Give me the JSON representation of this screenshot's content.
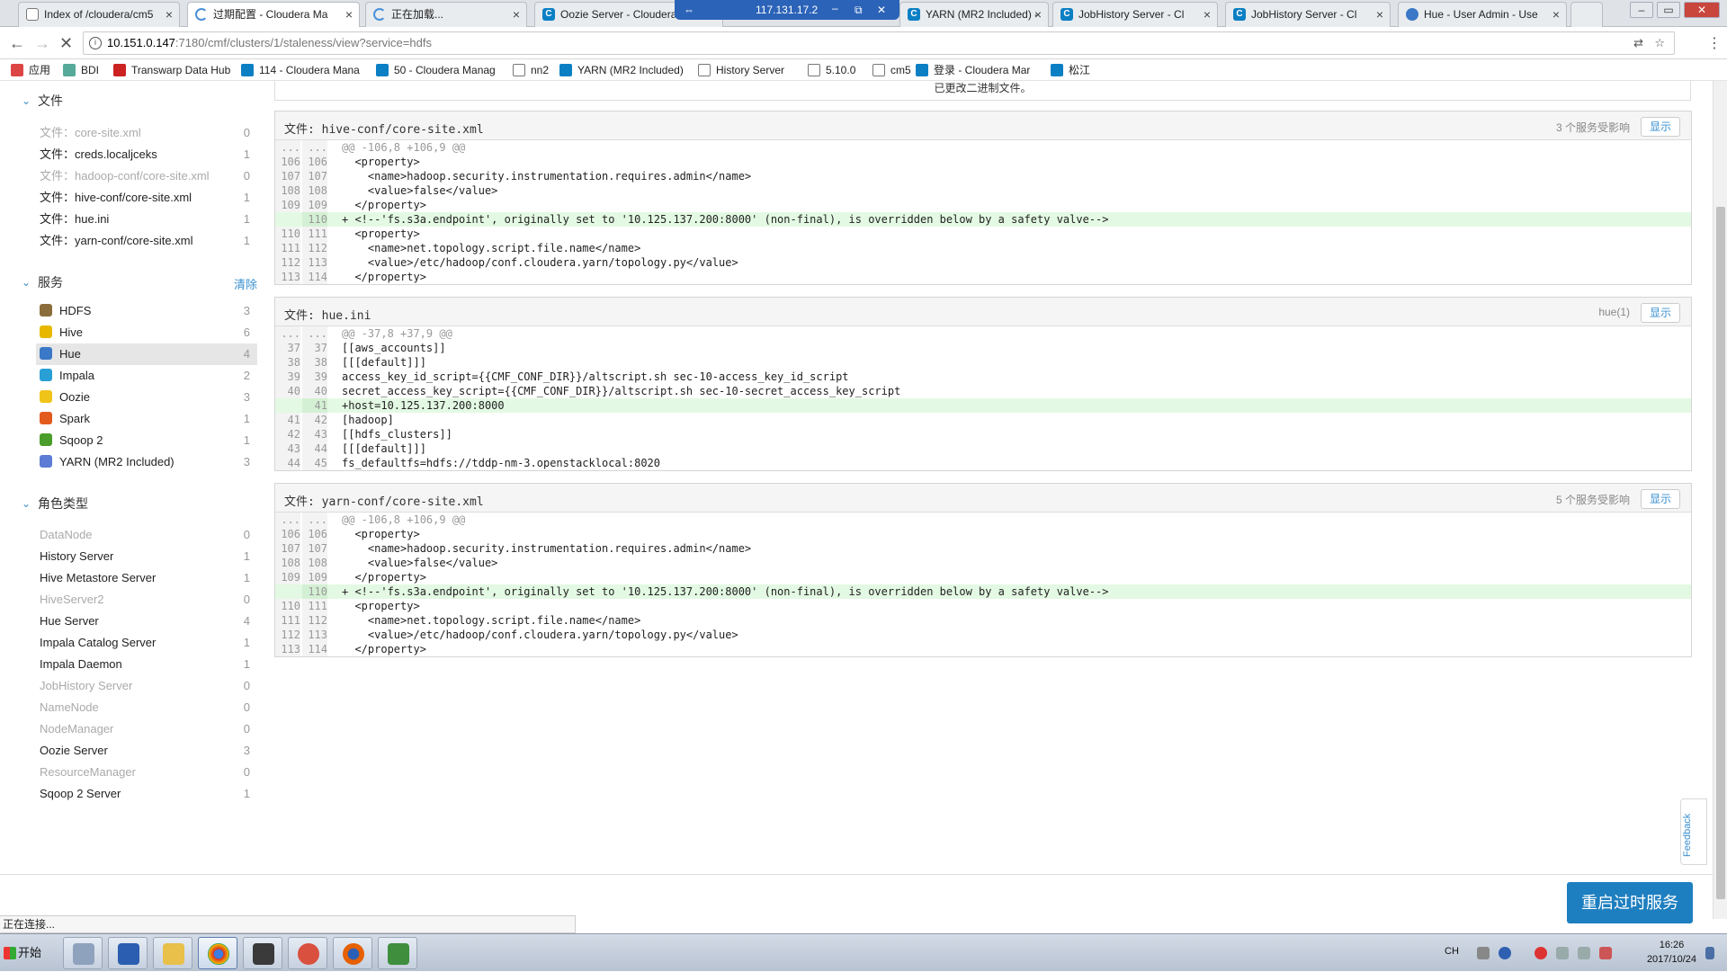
{
  "browser": {
    "tabs": [
      {
        "label": "Index of /cloudera/cm5",
        "icon": "doc"
      },
      {
        "label": "过期配置 - Cloudera Ma",
        "icon": "spinner",
        "active": true
      },
      {
        "label": "正在加载...",
        "icon": "spinner"
      },
      {
        "label": "Oozie Server - Cloudera",
        "icon": "cloudera"
      },
      {
        "label": "YARN (MR2 Included) - ",
        "icon": "cloudera"
      },
      {
        "label": "JobHistory Server - Cl",
        "icon": "cloudera"
      },
      {
        "label": "JobHistory Server - Cl",
        "icon": "cloudera"
      },
      {
        "label": "Hue - User Admin - Use",
        "icon": "hue"
      }
    ],
    "remote_bar_ip": "117.131.17.2",
    "url_host": "10.151.0.147",
    "url_rest": ":7180/cmf/clusters/1/staleness/view?service=hdfs",
    "bookmarks": [
      {
        "label": "应用"
      },
      {
        "label": "BDI"
      },
      {
        "label": "Transwarp Data Hub"
      },
      {
        "label": "114 - Cloudera Mana"
      },
      {
        "label": "50 - Cloudera Manag"
      },
      {
        "label": "nn2"
      },
      {
        "label": "YARN (MR2 Included)"
      },
      {
        "label": "History Server"
      },
      {
        "label": "5.10.0"
      },
      {
        "label": "cm5"
      },
      {
        "label": "登录 - Cloudera Mar"
      },
      {
        "label": "松江"
      }
    ]
  },
  "top_message": "已更改二进制文件。",
  "sidebar": {
    "files_title": "文件",
    "files": [
      {
        "label": "文件：core-site.xml",
        "count": "0",
        "dim": true
      },
      {
        "label": "文件：creds.localjceks",
        "count": "1",
        "dim": false
      },
      {
        "label": "文件：hadoop-conf/core-site.xml",
        "count": "0",
        "dim": true
      },
      {
        "label": "文件：hive-conf/core-site.xml",
        "count": "1",
        "dim": false
      },
      {
        "label": "文件：hue.ini",
        "count": "1",
        "dim": false
      },
      {
        "label": "文件：yarn-conf/core-site.xml",
        "count": "1",
        "dim": false
      }
    ],
    "services_title": "服务",
    "clear_label": "清除",
    "services": [
      {
        "label": "HDFS",
        "count": "3",
        "color": "#8a6d3b"
      },
      {
        "label": "Hive",
        "count": "6",
        "color": "#e6b800"
      },
      {
        "label": "Hue",
        "count": "4",
        "color": "#3b78c7",
        "selected": true
      },
      {
        "label": "Impala",
        "count": "2",
        "color": "#2a9fd6"
      },
      {
        "label": "Oozie",
        "count": "3",
        "color": "#f0c419"
      },
      {
        "label": "Spark",
        "count": "1",
        "color": "#e25a1c"
      },
      {
        "label": "Sqoop 2",
        "count": "1",
        "color": "#4a9d2a"
      },
      {
        "label": "YARN (MR2 Included)",
        "count": "3",
        "color": "#5b7bd5"
      }
    ],
    "roles_title": "角色类型",
    "roles": [
      {
        "label": "DataNode",
        "count": "0",
        "dim": true
      },
      {
        "label": "History Server",
        "count": "1",
        "dim": false
      },
      {
        "label": "Hive Metastore Server",
        "count": "1",
        "dim": false
      },
      {
        "label": "HiveServer2",
        "count": "0",
        "dim": true
      },
      {
        "label": "Hue Server",
        "count": "4",
        "dim": false
      },
      {
        "label": "Impala Catalog Server",
        "count": "1",
        "dim": false
      },
      {
        "label": "Impala Daemon",
        "count": "1",
        "dim": false
      },
      {
        "label": "JobHistory Server",
        "count": "0",
        "dim": true
      },
      {
        "label": "NameNode",
        "count": "0",
        "dim": true
      },
      {
        "label": "NodeManager",
        "count": "0",
        "dim": true
      },
      {
        "label": "Oozie Server",
        "count": "3",
        "dim": false
      },
      {
        "label": "ResourceManager",
        "count": "0",
        "dim": true
      },
      {
        "label": "Sqoop 2 Server",
        "count": "1",
        "dim": false
      }
    ]
  },
  "panels": [
    {
      "title": "文件: hive-conf/core-site.xml",
      "affected": "3 个服务受影响",
      "button": "显示",
      "lines": [
        {
          "a": "...",
          "b": "...",
          "text": "@@ -106,8 +106,9 @@",
          "kind": "hunk"
        },
        {
          "a": "106",
          "b": "106",
          "text": "  <property>",
          "kind": "ctx"
        },
        {
          "a": "107",
          "b": "107",
          "text": "    <name>hadoop.security.instrumentation.requires.admin</name>",
          "kind": "ctx"
        },
        {
          "a": "108",
          "b": "108",
          "text": "    <value>false</value>",
          "kind": "ctx"
        },
        {
          "a": "109",
          "b": "109",
          "text": "  </property>",
          "kind": "ctx"
        },
        {
          "a": "",
          "b": "110",
          "text": "+ <!--'fs.s3a.endpoint', originally set to '10.125.137.200:8000' (non-final), is overridden below by a safety valve-->",
          "kind": "add"
        },
        {
          "a": "110",
          "b": "111",
          "text": "  <property>",
          "kind": "ctx"
        },
        {
          "a": "111",
          "b": "112",
          "text": "    <name>net.topology.script.file.name</name>",
          "kind": "ctx"
        },
        {
          "a": "112",
          "b": "113",
          "text": "    <value>/etc/hadoop/conf.cloudera.yarn/topology.py</value>",
          "kind": "ctx"
        },
        {
          "a": "113",
          "b": "114",
          "text": "  </property>",
          "kind": "ctx"
        }
      ]
    },
    {
      "title": "文件: hue.ini",
      "affected": "hue(1)",
      "button": "显示",
      "lines": [
        {
          "a": "...",
          "b": "...",
          "text": "@@ -37,8 +37,9 @@",
          "kind": "hunk"
        },
        {
          "a": "37",
          "b": "37",
          "text": "[[aws_accounts]]",
          "kind": "ctx"
        },
        {
          "a": "38",
          "b": "38",
          "text": "[[[default]]]",
          "kind": "ctx"
        },
        {
          "a": "39",
          "b": "39",
          "text": "access_key_id_script={{CMF_CONF_DIR}}/altscript.sh sec-10-access_key_id_script",
          "kind": "ctx"
        },
        {
          "a": "40",
          "b": "40",
          "text": "secret_access_key_script={{CMF_CONF_DIR}}/altscript.sh sec-10-secret_access_key_script",
          "kind": "ctx"
        },
        {
          "a": "",
          "b": "41",
          "text": "+host=10.125.137.200:8000",
          "kind": "add"
        },
        {
          "a": "41",
          "b": "42",
          "text": "[hadoop]",
          "kind": "ctx"
        },
        {
          "a": "42",
          "b": "43",
          "text": "[[hdfs_clusters]]",
          "kind": "ctx"
        },
        {
          "a": "43",
          "b": "44",
          "text": "[[[default]]]",
          "kind": "ctx"
        },
        {
          "a": "44",
          "b": "45",
          "text": "fs_defaultfs=hdfs://tddp-nm-3.openstacklocal:8020",
          "kind": "ctx"
        }
      ]
    },
    {
      "title": "文件: yarn-conf/core-site.xml",
      "affected": "5 个服务受影响",
      "button": "显示",
      "lines": [
        {
          "a": "...",
          "b": "...",
          "text": "@@ -106,8 +106,9 @@",
          "kind": "hunk"
        },
        {
          "a": "106",
          "b": "106",
          "text": "  <property>",
          "kind": "ctx"
        },
        {
          "a": "107",
          "b": "107",
          "text": "    <name>hadoop.security.instrumentation.requires.admin</name>",
          "kind": "ctx"
        },
        {
          "a": "108",
          "b": "108",
          "text": "    <value>false</value>",
          "kind": "ctx"
        },
        {
          "a": "109",
          "b": "109",
          "text": "  </property>",
          "kind": "ctx"
        },
        {
          "a": "",
          "b": "110",
          "text": "+ <!--'fs.s3a.endpoint', originally set to '10.125.137.200:8000' (non-final), is overridden below by a safety valve-->",
          "kind": "add"
        },
        {
          "a": "110",
          "b": "111",
          "text": "  <property>",
          "kind": "ctx"
        },
        {
          "a": "111",
          "b": "112",
          "text": "    <name>net.topology.script.file.name</name>",
          "kind": "ctx"
        },
        {
          "a": "112",
          "b": "113",
          "text": "    <value>/etc/hadoop/conf.cloudera.yarn/topology.py</value>",
          "kind": "ctx"
        },
        {
          "a": "113",
          "b": "114",
          "text": "  </property>",
          "kind": "ctx"
        }
      ]
    }
  ],
  "feedback_label": "Feedback",
  "restart_button": "重启过时服务",
  "status_text": "正在连接...",
  "taskbar": {
    "start_label": "开始",
    "lang": "CH",
    "time": "16:26",
    "date": "2017/10/24"
  },
  "colors": {
    "accent": "#1e7fc0",
    "added_line": "#e3f9e3"
  }
}
